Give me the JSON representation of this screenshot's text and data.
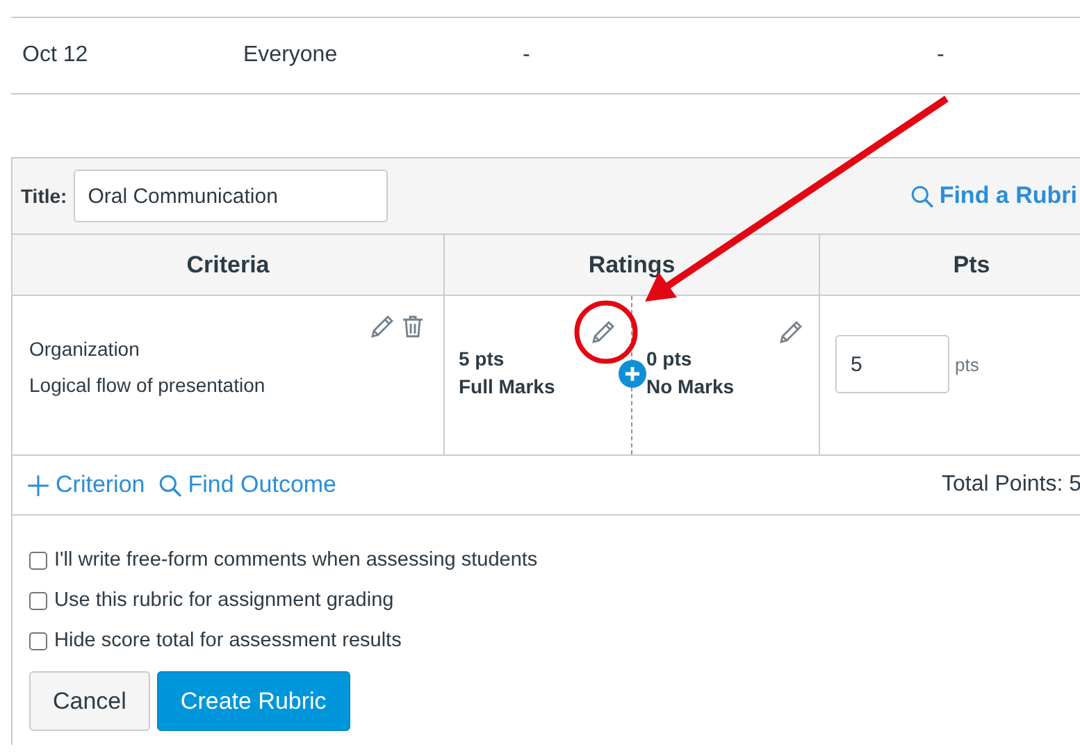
{
  "table_row": {
    "cells": [
      "Oct 12",
      "Everyone",
      "-",
      "-"
    ]
  },
  "rubric": {
    "title_label": "Title:",
    "title": "Oral Communication",
    "find_rubric": "Find a Rubri",
    "columns": [
      "Criteria",
      "Ratings",
      "Pts"
    ],
    "criteria": [
      {
        "name": "Organization",
        "description": "Logical flow of presentation",
        "ratings": [
          {
            "points": "5 pts",
            "label": "Full Marks"
          },
          {
            "points": "0 pts",
            "label": "No Marks"
          }
        ],
        "points": "5",
        "unit": "pts"
      }
    ],
    "add_criterion": "Criterion",
    "find_outcome": "Find Outcome",
    "total": "Total Points: 5"
  },
  "options": [
    {
      "label": "I'll write free-form comments when assessing students",
      "checked": false
    },
    {
      "label": "Use this rubric for assignment grading",
      "checked": false
    },
    {
      "label": "Hide score total for assessment results",
      "checked": false
    }
  ],
  "buttons": [
    {
      "label": "Cancel",
      "kind": "secondary"
    },
    {
      "label": "Create Rubric",
      "kind": "primary"
    }
  ]
}
